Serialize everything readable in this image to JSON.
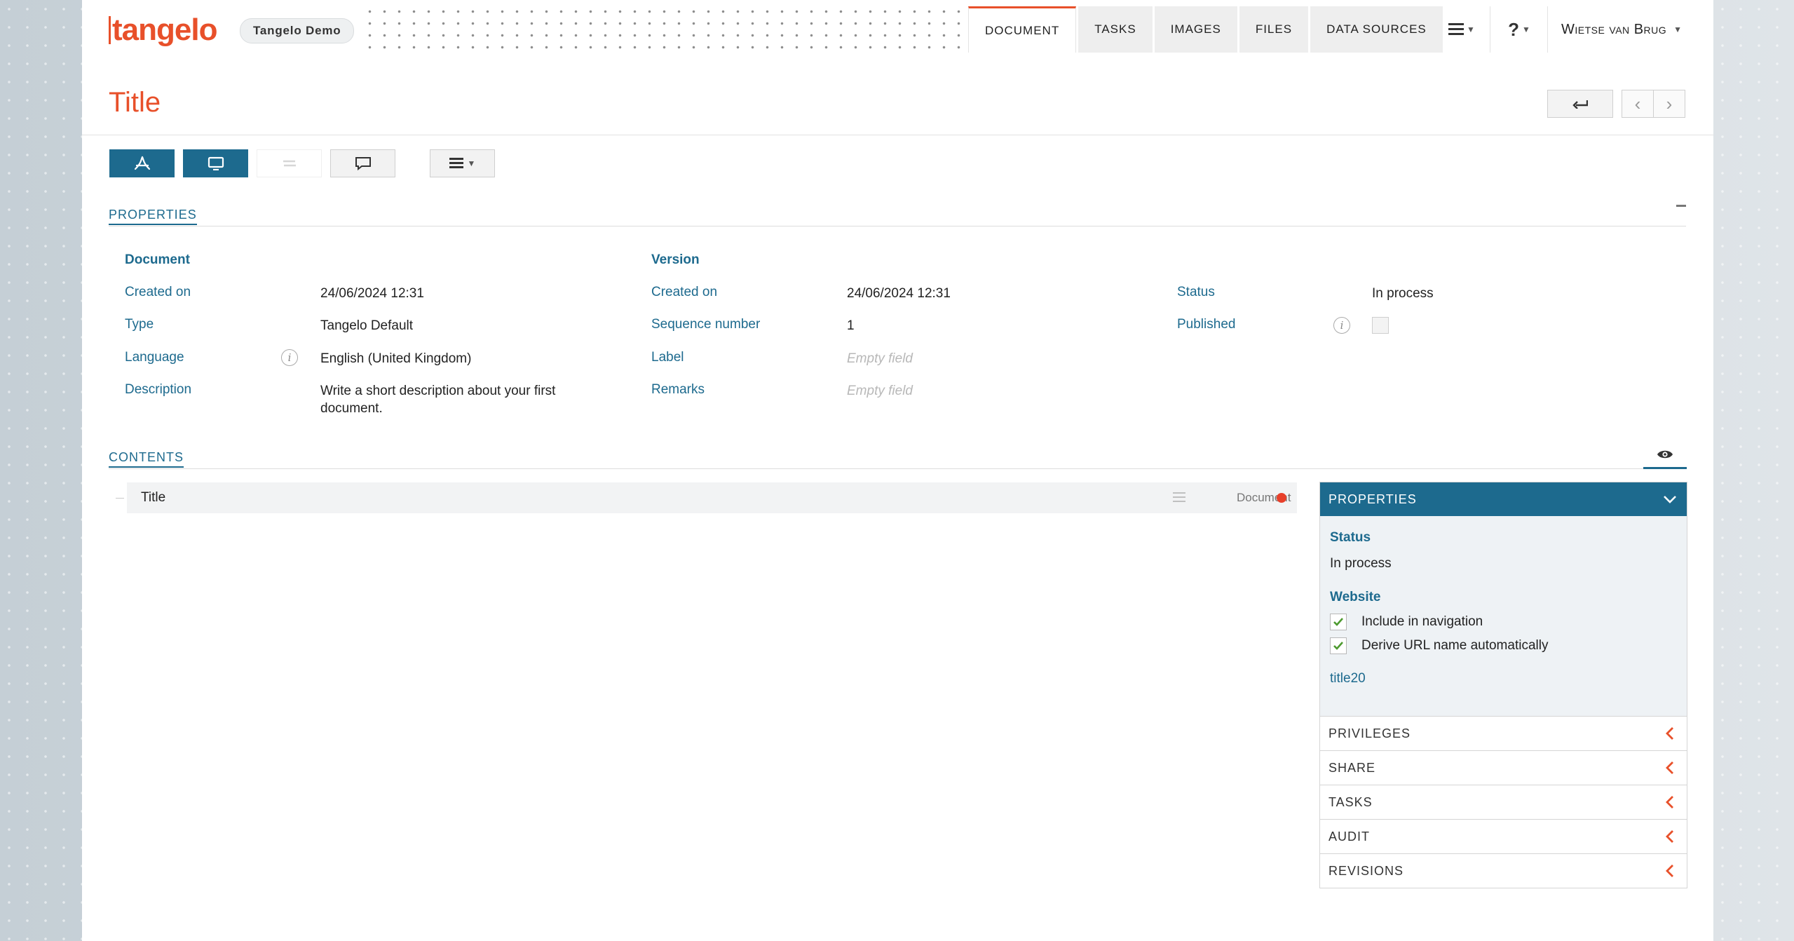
{
  "app": {
    "logo_text": "tangelo",
    "environment": "Tangelo Demo",
    "brand_color": "#e8502a",
    "accent_color": "#1d6a8e"
  },
  "nav": {
    "tabs": [
      {
        "label": "DOCUMENT",
        "active": true
      },
      {
        "label": "TASKS",
        "active": false
      },
      {
        "label": "IMAGES",
        "active": false
      },
      {
        "label": "FILES",
        "active": false
      },
      {
        "label": "DATA SOURCES",
        "active": false
      }
    ],
    "menu_icon": "hamburger-icon",
    "help_label": "?",
    "user_name": "Wietse van Brug"
  },
  "page": {
    "title": "Title",
    "back_icon": "return-arrow-icon",
    "prev_icon": "chevron-left-icon",
    "next_icon": "chevron-right-icon"
  },
  "toolbar": {
    "buttons": [
      "pdf-icon",
      "monitor-icon",
      "compare-icon",
      "comment-icon",
      "list-menu-icon"
    ]
  },
  "properties": {
    "section_label": "PROPERTIES",
    "document": {
      "heading": "Document",
      "created_on_label": "Created on",
      "created_on": "24/06/2024 12:31",
      "type_label": "Type",
      "type": "Tangelo Default",
      "language_label": "Language",
      "language": "English (United Kingdom)",
      "description_label": "Description",
      "description": "Write a short description about your first document."
    },
    "version": {
      "heading": "Version",
      "created_on_label": "Created on",
      "created_on": "24/06/2024 12:31",
      "sequence_label": "Sequence number",
      "sequence": "1",
      "label_label": "Label",
      "label": "Empty field",
      "remarks_label": "Remarks",
      "remarks": "Empty field"
    },
    "state": {
      "status_label": "Status",
      "status": "In process",
      "published_label": "Published",
      "published": false
    }
  },
  "contents": {
    "section_label": "CONTENTS",
    "items": [
      {
        "title": "Title",
        "type": "Document",
        "status_color": "#e8402a"
      }
    ]
  },
  "side_panel": {
    "header": "PROPERTIES",
    "status_label": "Status",
    "status": "In process",
    "website_label": "Website",
    "include_nav": "Include in navigation",
    "include_nav_checked": true,
    "derive_url": "Derive URL name automatically",
    "derive_url_checked": true,
    "url_name": "title20",
    "sections": [
      "PRIVILEGES",
      "SHARE",
      "TASKS",
      "AUDIT",
      "REVISIONS"
    ]
  }
}
